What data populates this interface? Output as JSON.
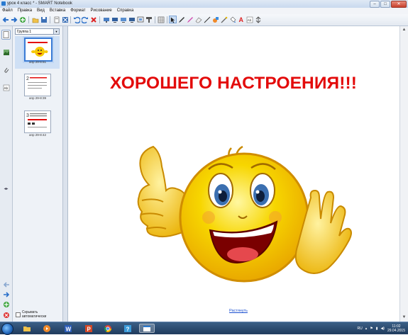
{
  "window": {
    "title": "урок 4 класс * - SMART Notebook"
  },
  "menu": [
    "Файл",
    "Правка",
    "Вид",
    "Вставка",
    "Формат",
    "Рисование",
    "Справка"
  ],
  "sorter": {
    "group_label": "Группа 1",
    "pages": [
      {
        "label": "апр 29-8:51",
        "selected": true
      },
      {
        "label": "апр 29-8:39",
        "selected": false
      },
      {
        "label": "апр 29-8:42",
        "selected": false
      }
    ],
    "autohide_label": "Скрывать автоматически"
  },
  "canvas": {
    "headline": "ХОРОШЕГО НАСТРОЕНИЯ!!!",
    "extend_link": "Растянуть"
  },
  "taskbar": {
    "language": "RU",
    "time": "11:02",
    "date": "29.04.2015"
  },
  "colors": {
    "headline": "#e30b0b",
    "smiley_face": "#f6c800",
    "selection": "#3a7bd5"
  }
}
